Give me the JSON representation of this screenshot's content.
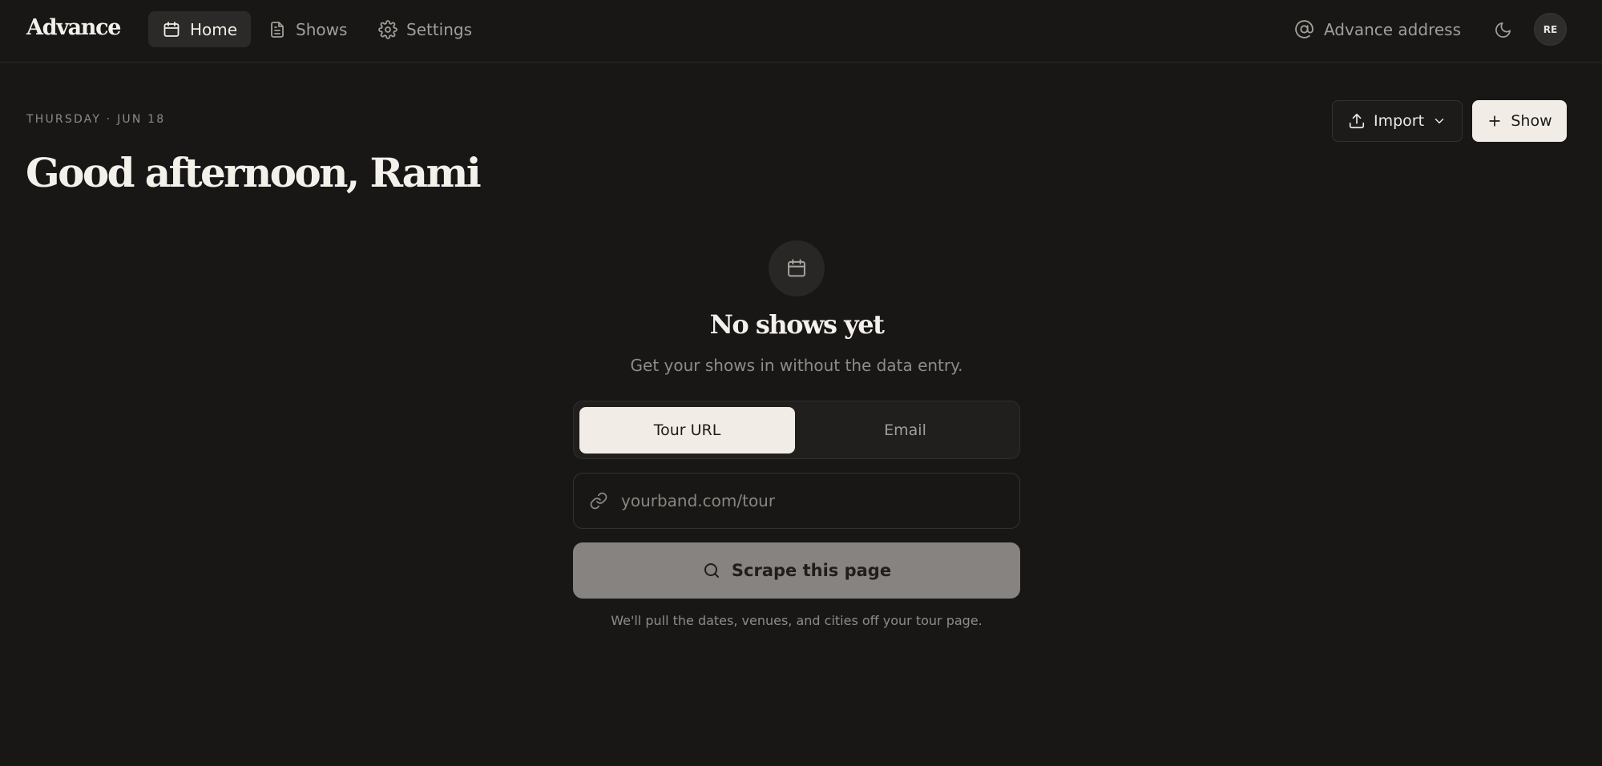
{
  "brand": "Advance",
  "nav": {
    "items": [
      {
        "label": "Home",
        "icon": "calendar-icon",
        "active": true
      },
      {
        "label": "Shows",
        "icon": "document-icon",
        "active": false
      },
      {
        "label": "Settings",
        "icon": "gear-icon",
        "active": false
      }
    ],
    "address_label": "Advance address",
    "theme_icon": "moon-icon",
    "avatar_initials": "RE"
  },
  "header": {
    "date": "THURSDAY · JUN 18",
    "greeting": "Good afternoon, Rami",
    "import_label": "Import",
    "show_label": "Show"
  },
  "empty_state": {
    "icon": "calendar-icon",
    "title": "No shows yet",
    "subtitle": "Get your shows in without the data entry.",
    "tabs": [
      {
        "label": "Tour URL",
        "active": true
      },
      {
        "label": "Email",
        "active": false
      }
    ],
    "url_placeholder": "yourband.com/tour",
    "url_value": "",
    "scrape_label": "Scrape this page",
    "helper": "We'll pull the dates, venues, and cities off your tour page."
  },
  "colors": {
    "background": "#181716",
    "text": "#ece9e4",
    "muted": "#8f8b85",
    "active_surface": "#f1ede6",
    "disabled_button": "#868380"
  }
}
